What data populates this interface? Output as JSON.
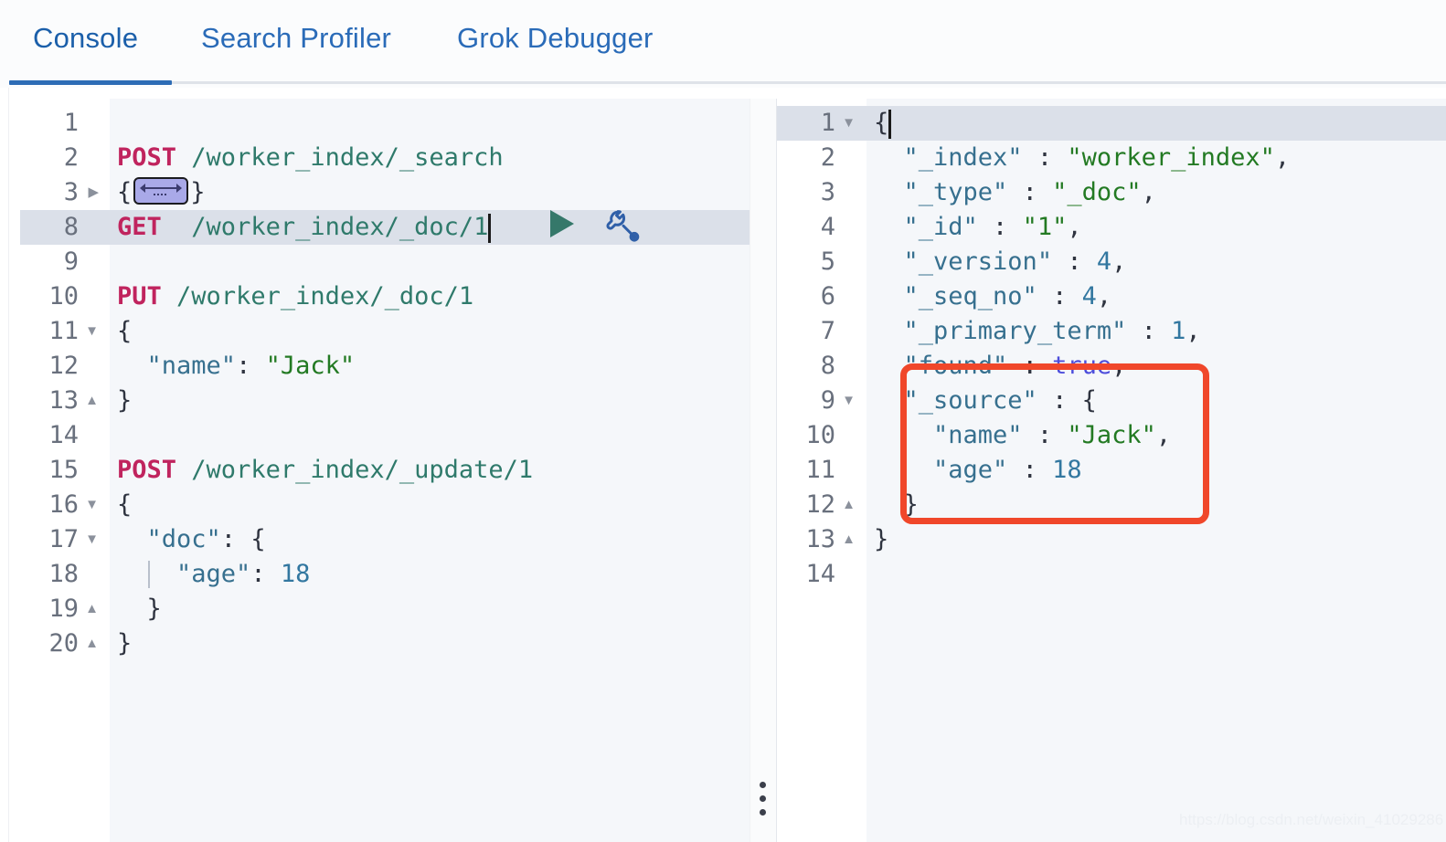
{
  "window": {
    "app": "Kibana Dev Tools Console"
  },
  "tabs": [
    {
      "label": "Console",
      "active": true
    },
    {
      "label": "Search Profiler",
      "active": false
    },
    {
      "label": "Grok Debugger",
      "active": false
    }
  ],
  "colors": {
    "tab_accent": "#2d6cb5",
    "tab_text": "#2a6bb8",
    "method": "#c0245e",
    "url": "#2f7a6b",
    "json_key": "#37708f",
    "json_string": "#237a23",
    "json_number": "#3277a0",
    "json_boolean": "#4d4ddb",
    "active_line": "#dbe0e9",
    "editor_bg": "#f5f7fa",
    "gutter_bg": "#ffffff",
    "annotation": "#f0472a",
    "play_icon": "#35786a",
    "wrench_icon": "#2f5fa8"
  },
  "request_editor": {
    "active_line_number": "8",
    "lines": [
      {
        "n": "1",
        "fold": "",
        "active": false,
        "text": ""
      },
      {
        "n": "2",
        "fold": "",
        "active": false,
        "text": "POST /worker_index/_search"
      },
      {
        "n": "3",
        "fold": "collapsed",
        "active": false,
        "text": "{ ... }"
      },
      {
        "n": "8",
        "fold": "",
        "active": true,
        "text": "GET  /worker_index/_doc/1"
      },
      {
        "n": "9",
        "fold": "",
        "active": false,
        "text": ""
      },
      {
        "n": "10",
        "fold": "",
        "active": false,
        "text": "PUT /worker_index/_doc/1"
      },
      {
        "n": "11",
        "fold": "open",
        "active": false,
        "text": "{"
      },
      {
        "n": "12",
        "fold": "",
        "active": false,
        "text": "  \"name\": \"Jack\""
      },
      {
        "n": "13",
        "fold": "end",
        "active": false,
        "text": "}"
      },
      {
        "n": "14",
        "fold": "",
        "active": false,
        "text": ""
      },
      {
        "n": "15",
        "fold": "",
        "active": false,
        "text": "POST /worker_index/_update/1"
      },
      {
        "n": "16",
        "fold": "open",
        "active": false,
        "text": "{"
      },
      {
        "n": "17",
        "fold": "open",
        "active": false,
        "text": "  \"doc\": {"
      },
      {
        "n": "18",
        "fold": "",
        "active": false,
        "text": "    \"age\": 18"
      },
      {
        "n": "19",
        "fold": "end",
        "active": false,
        "text": "  }"
      },
      {
        "n": "20",
        "fold": "end",
        "active": false,
        "text": "}"
      }
    ],
    "actions": {
      "play_label": "play-request",
      "wrench_label": "request-options"
    }
  },
  "response_editor": {
    "active_line_number": "1",
    "lines": [
      {
        "n": "1",
        "fold": "open",
        "active": true,
        "text": "{"
      },
      {
        "n": "2",
        "fold": "",
        "active": false,
        "text": "  \"_index\" : \"worker_index\","
      },
      {
        "n": "3",
        "fold": "",
        "active": false,
        "text": "  \"_type\" : \"_doc\","
      },
      {
        "n": "4",
        "fold": "",
        "active": false,
        "text": "  \"_id\" : \"1\","
      },
      {
        "n": "5",
        "fold": "",
        "active": false,
        "text": "  \"_version\" : 4,"
      },
      {
        "n": "6",
        "fold": "",
        "active": false,
        "text": "  \"_seq_no\" : 4,"
      },
      {
        "n": "7",
        "fold": "",
        "active": false,
        "text": "  \"_primary_term\" : 1,"
      },
      {
        "n": "8",
        "fold": "",
        "active": false,
        "text": "  \"found\" : true,"
      },
      {
        "n": "9",
        "fold": "open",
        "active": false,
        "text": "  \"_source\" : {"
      },
      {
        "n": "10",
        "fold": "",
        "active": false,
        "text": "    \"name\" : \"Jack\","
      },
      {
        "n": "11",
        "fold": "",
        "active": false,
        "text": "    \"age\" : 18"
      },
      {
        "n": "12",
        "fold": "end",
        "active": false,
        "text": "  }"
      },
      {
        "n": "13",
        "fold": "end",
        "active": false,
        "text": "}"
      },
      {
        "n": "14",
        "fold": "",
        "active": false,
        "text": ""
      }
    ],
    "response_body": {
      "_index": "worker_index",
      "_type": "_doc",
      "_id": "1",
      "_version": 4,
      "_seq_no": 4,
      "_primary_term": 1,
      "found": true,
      "_source": {
        "name": "Jack",
        "age": 18
      }
    }
  },
  "annotation": {
    "label": "source-highlight-box",
    "color": "#f0472a"
  },
  "watermark": {
    "text": "https://blog.csdn.net/weixin_41029286"
  }
}
